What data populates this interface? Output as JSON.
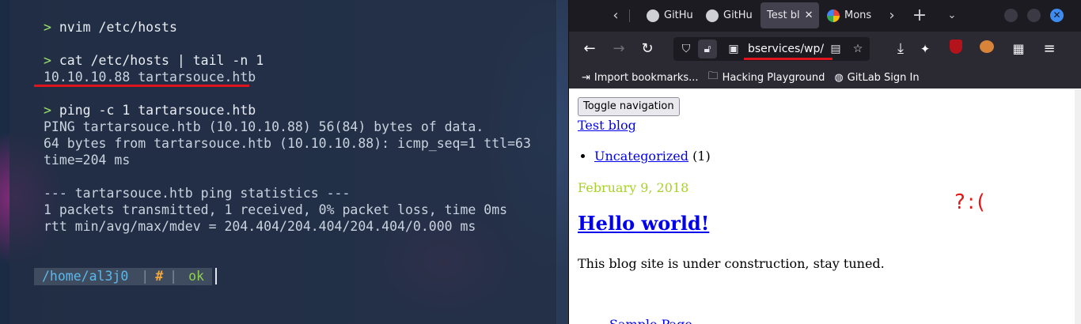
{
  "terminal": {
    "lines": [
      {
        "prompt": ">",
        "cmd": "nvim /etc/hosts"
      },
      {
        "prompt": ">",
        "cmd": "cat /etc/hosts | tail -n 1"
      },
      {
        "output": "10.10.10.88 tartarsouce.htb"
      },
      {
        "prompt": ">",
        "cmd": "ping -c 1 tartarsouce.htb"
      },
      {
        "output": "PING tartarsouce.htb (10.10.10.88) 56(84) bytes of data."
      },
      {
        "output": "64 bytes from tartarsouce.htb (10.10.10.88): icmp_seq=1 ttl=63"
      },
      {
        "output": "time=204 ms"
      },
      {
        "output": "--- tartarsouce.htb ping statistics ---"
      },
      {
        "output": "1 packets transmitted, 1 received, 0% packet loss, time 0ms"
      },
      {
        "output": "rtt min/avg/max/mdev = 204.404/204.404/204.404/0.000 ms"
      }
    ],
    "ps1": {
      "path": "/home/al3j0",
      "separator": "|",
      "user_symbol": "#",
      "status": "ok"
    },
    "highlight_color": "#e0141e"
  },
  "browser": {
    "tabs": [
      {
        "label": "GitHu",
        "icon": "github-icon"
      },
      {
        "label": "GitHu",
        "icon": "github-icon"
      },
      {
        "label": "Test bl",
        "icon": "none",
        "active": true
      },
      {
        "label": "Mons",
        "icon": "google-icon"
      }
    ],
    "tab_close": "✕",
    "url": "bservices/wp/",
    "bookmarks": [
      {
        "label": "Import bookmarks...",
        "icon": "import-icon"
      },
      {
        "label": "Hacking Playground",
        "icon": "folder-icon"
      },
      {
        "label": "GitLab Sign In",
        "icon": "globe-icon"
      }
    ],
    "page": {
      "toggle_button": "Toggle navigation",
      "site_title": "Test blog",
      "category_link": "Uncategorized",
      "category_count": "(1)",
      "post_date": "February 9, 2018",
      "post_title": "Hello world!",
      "post_body": "This blog site is under construction, stay tuned.",
      "sample_page_link": "Sample Page",
      "annotation": "?:("
    },
    "colors": {
      "accent_blue": "#3f8cf0",
      "link": "#0000ee",
      "date_green": "#a8d12a",
      "annotation_red": "#e01818"
    }
  }
}
